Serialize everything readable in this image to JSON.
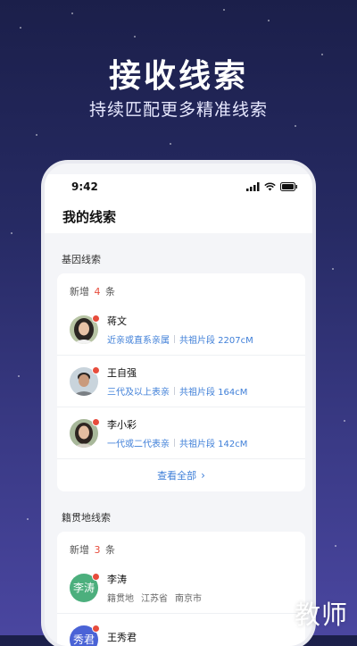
{
  "promo": {
    "headline": "接收线索",
    "subline": "持续匹配更多精准线索"
  },
  "status_bar": {
    "time": "9:42"
  },
  "page": {
    "title": "我的线索"
  },
  "gene_section": {
    "title": "基因线索",
    "new_prefix": "新增",
    "new_count": "4",
    "new_suffix": "条",
    "items": [
      {
        "name": "蒋文",
        "relation": "近亲或直系亲属",
        "segment": "共祖片段 2207cM"
      },
      {
        "name": "王自强",
        "relation": "三代及以上表亲",
        "segment": "共祖片段 164cM"
      },
      {
        "name": "李小彩",
        "relation": "一代或二代表亲",
        "segment": "共祖片段 142cM"
      }
    ],
    "view_all": "查看全部",
    "view_all_chevron": "›"
  },
  "origin_section": {
    "title": "籍贯地线索",
    "new_prefix": "新增",
    "new_count": "3",
    "new_suffix": "条",
    "items": [
      {
        "name": "李涛",
        "avatar_text": "李涛",
        "label": "籍贯地",
        "province": "江苏省",
        "city": "南京市",
        "avatar_color": "#4caf7d"
      },
      {
        "name": "王秀君",
        "avatar_text": "秀君",
        "avatar_color": "#4a63d6"
      }
    ]
  },
  "watermark": "教师"
}
